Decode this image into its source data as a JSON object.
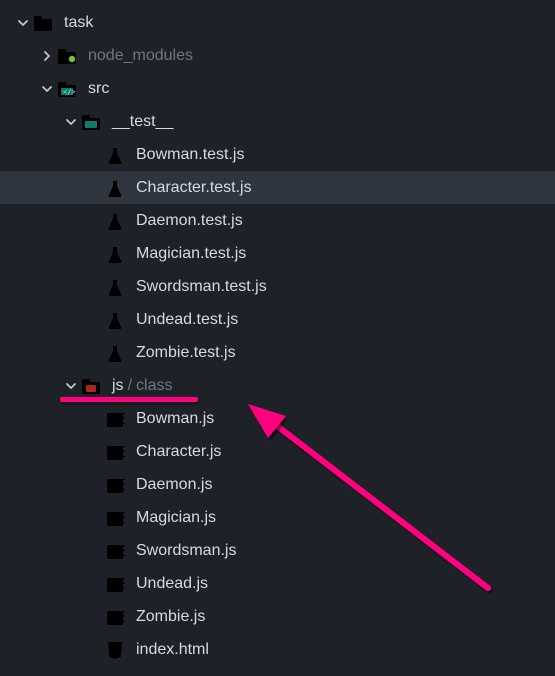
{
  "tree": {
    "root": {
      "name": "task"
    },
    "node_modules": {
      "name": "node_modules"
    },
    "src": {
      "name": "src"
    },
    "test_folder": {
      "name": "__test__"
    },
    "tests": [
      {
        "name": "Bowman.test.js"
      },
      {
        "name": "Character.test.js"
      },
      {
        "name": "Daemon.test.js"
      },
      {
        "name": "Magician.test.js"
      },
      {
        "name": "Swordsman.test.js"
      },
      {
        "name": "Undead.test.js"
      },
      {
        "name": "Zombie.test.js"
      }
    ],
    "js_folder": {
      "part1": "js",
      "sep": "/",
      "part2": "class"
    },
    "classes": [
      {
        "name": "Bowman.js"
      },
      {
        "name": "Character.js"
      },
      {
        "name": "Daemon.js"
      },
      {
        "name": "Magician.js"
      },
      {
        "name": "Swordsman.js"
      },
      {
        "name": "Undead.js"
      },
      {
        "name": "Zombie.js"
      }
    ],
    "index_html": {
      "name": "index.html"
    }
  },
  "selected_file": "Character.test.js",
  "annotation": {
    "underline_target": "js/class",
    "arrow_target": "Bowman.js"
  }
}
